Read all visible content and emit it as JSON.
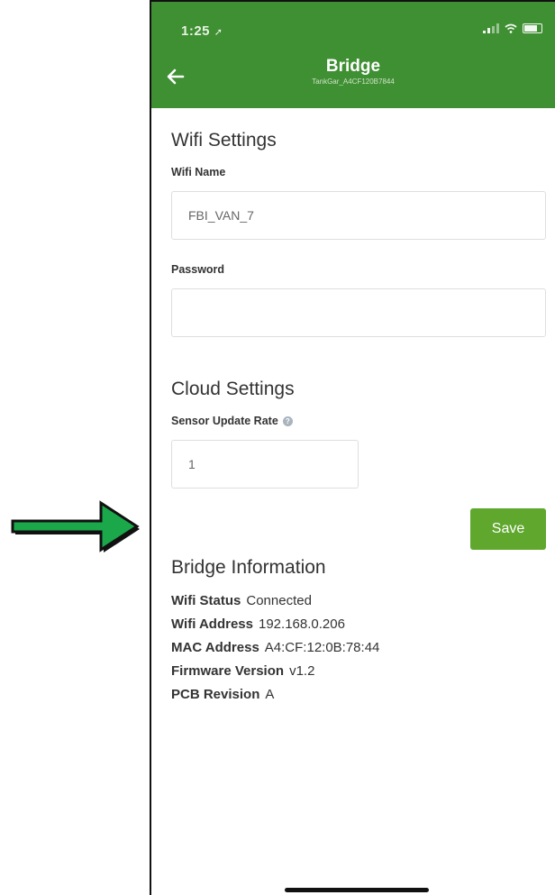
{
  "status_bar": {
    "time": "1:25",
    "location_glyph": "➚"
  },
  "header": {
    "title": "Bridge",
    "subtitle": "TankGar_A4CF120B7844",
    "back_icon": "back-arrow-icon",
    "color": "#3f8f33"
  },
  "wifi_settings": {
    "title": "Wifi Settings",
    "name_label": "Wifi Name",
    "name_value": "FBI_VAN_7",
    "password_label": "Password",
    "password_value": ""
  },
  "cloud_settings": {
    "title": "Cloud Settings",
    "rate_label": "Sensor Update Rate",
    "rate_value": "1",
    "help_glyph": "?"
  },
  "save_button": {
    "label": "Save",
    "color": "#5fa72d"
  },
  "bridge_info": {
    "title": "Bridge Information",
    "rows": [
      {
        "key": "Wifi Status",
        "value": "Connected"
      },
      {
        "key": "Wifi Address",
        "value": "192.168.0.206"
      },
      {
        "key": "MAC Address",
        "value": "A4:CF:12:0B:78:44"
      },
      {
        "key": "Firmware Version",
        "value": "v1.2"
      },
      {
        "key": "PCB Revision",
        "value": "A"
      }
    ]
  },
  "annotation": {
    "arrow_color": "#1aa84a"
  }
}
